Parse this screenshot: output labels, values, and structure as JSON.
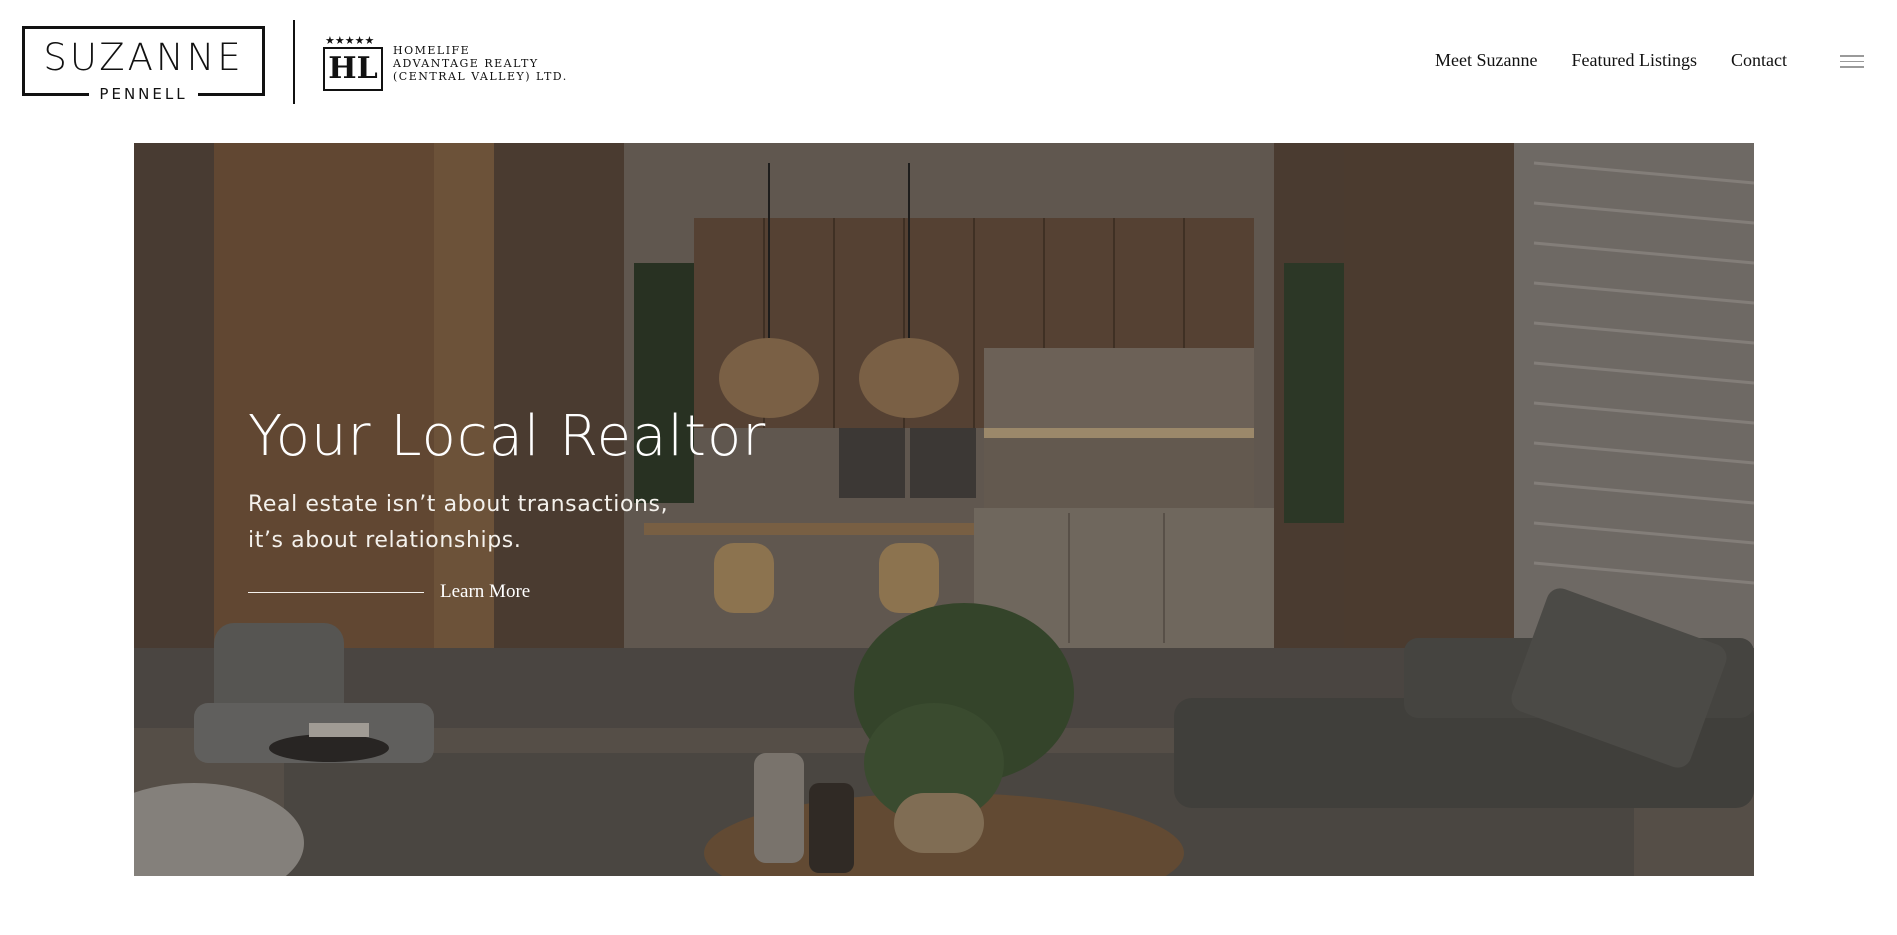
{
  "logo": {
    "name": "SUZANNE",
    "subname": "PENNELL"
  },
  "brokerage": {
    "stars": "★★★★★",
    "monogram": "HL",
    "line1": "HOMELIFE",
    "line2": "ADVANTAGE REALTY",
    "line3": "(CENTRAL VALLEY) LTD."
  },
  "nav": {
    "items": [
      {
        "label": "Meet Suzanne"
      },
      {
        "label": "Featured Listings"
      },
      {
        "label": "Contact"
      }
    ]
  },
  "hero": {
    "title": "Your Local Realtor",
    "subtitle": "Real estate isn’t about transactions,\n it’s about relationships.",
    "cta_label": "Learn More"
  },
  "icons": {
    "menu": "hamburger-menu-icon"
  },
  "colors": {
    "text": "#111111",
    "hero_text": "#ffffff",
    "menu_icon": "#9a9a9a"
  }
}
